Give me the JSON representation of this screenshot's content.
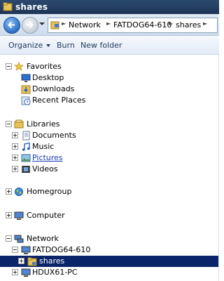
{
  "window": {
    "title": "shares"
  },
  "address": {
    "crumbs": [
      "Network",
      "FATDOG64-610",
      "shares"
    ]
  },
  "toolbar": {
    "organize_label": "Organize",
    "burn_label": "Burn",
    "new_folder_label": "New folder"
  },
  "favorites": {
    "header": "Favorites",
    "items": [
      {
        "label": "Desktop",
        "icon": "desktop-icon"
      },
      {
        "label": "Downloads",
        "icon": "downloads-icon"
      },
      {
        "label": "Recent Places",
        "icon": "recent-places-icon"
      }
    ]
  },
  "libraries": {
    "header": "Libraries",
    "items": [
      {
        "label": "Documents",
        "icon": "documents-icon"
      },
      {
        "label": "Music",
        "icon": "music-icon"
      },
      {
        "label": "Pictures",
        "icon": "pictures-icon"
      },
      {
        "label": "Videos",
        "icon": "videos-icon"
      }
    ]
  },
  "homegroup": {
    "label": "Homegroup"
  },
  "computer": {
    "label": "Computer"
  },
  "network": {
    "header": "Network",
    "hosts": [
      {
        "label": "FATDOG64-610",
        "children": [
          {
            "label": "shares",
            "selected": true
          }
        ]
      },
      {
        "label": "HDUX61-PC"
      }
    ]
  },
  "colors": {
    "titlebar": "#1e3556",
    "selection": "#0a246a",
    "toolbar_text": "#1e395b"
  }
}
